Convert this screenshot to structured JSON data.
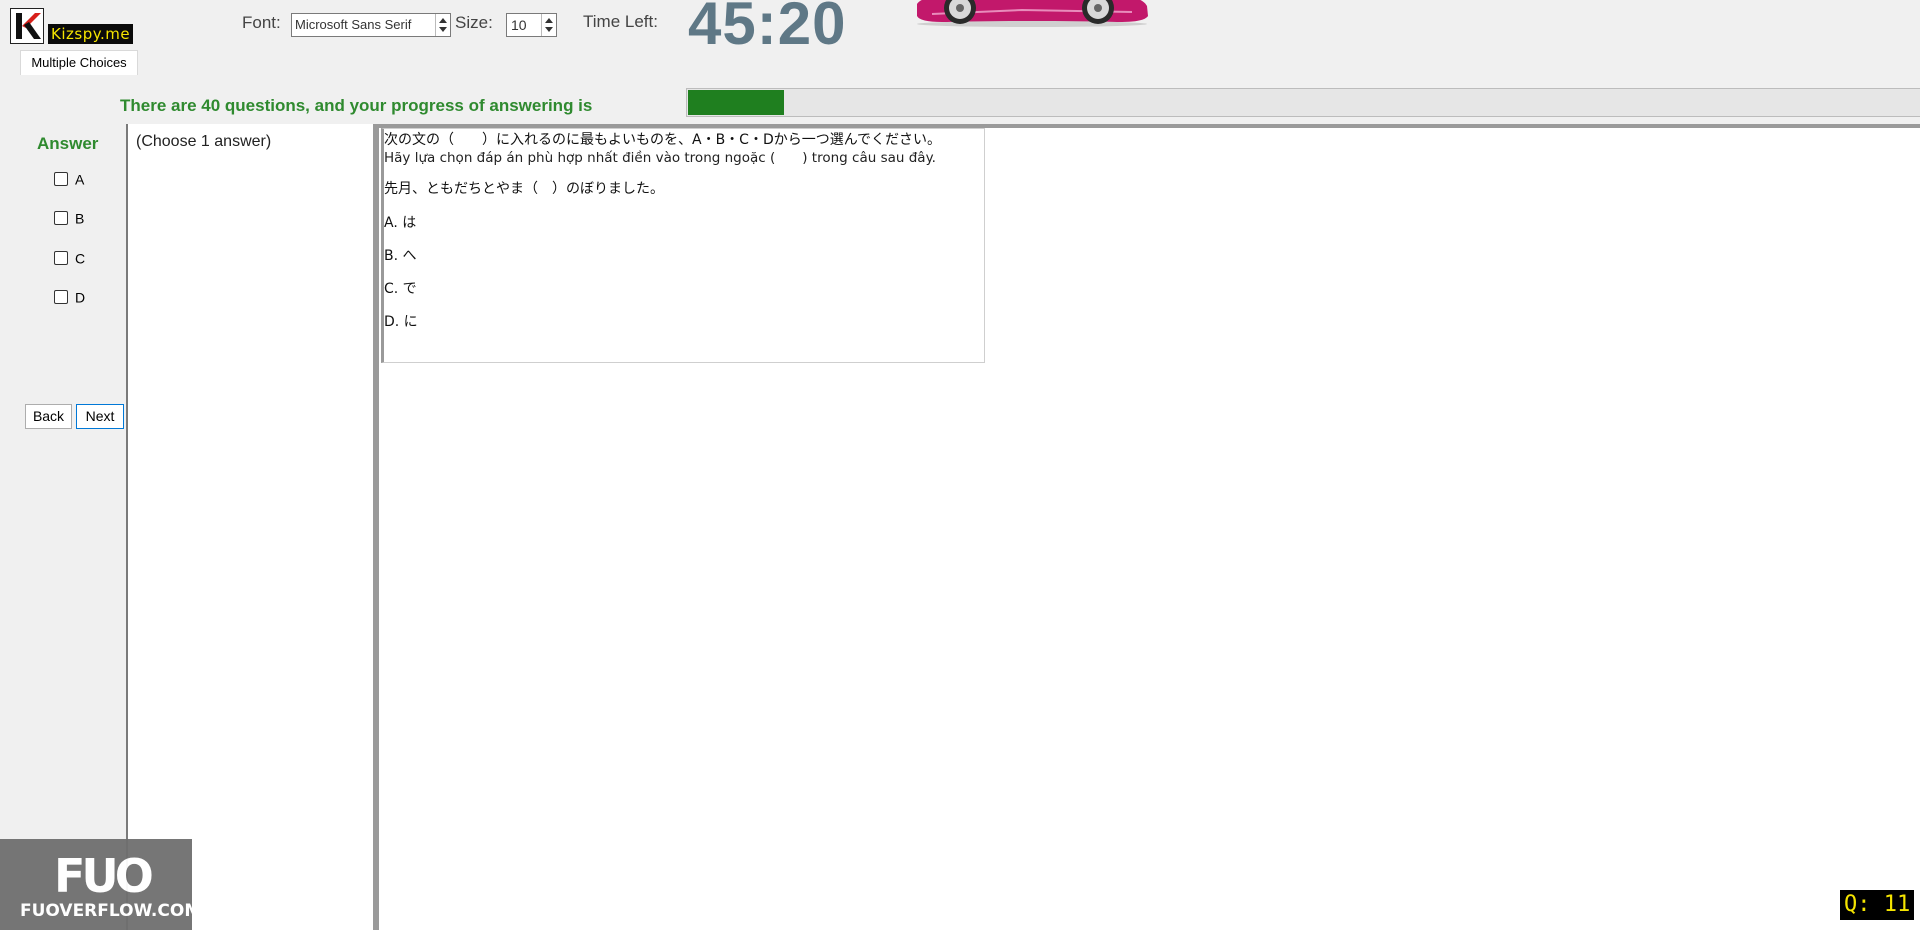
{
  "app": {
    "brand": "Kizspy.me",
    "tab_label": "Multiple Choices"
  },
  "header": {
    "font_label": "Font:",
    "font_value": "Microsoft Sans Serif",
    "size_label": "Size:",
    "size_value": "10",
    "time_label": "Time Left:",
    "timer": "45:20"
  },
  "progress": {
    "text": "There are 40 questions, and your progress of answering is",
    "fraction": 0.0775,
    "color": "#1f7f1f"
  },
  "answer": {
    "title": "Answer",
    "options": [
      "A",
      "B",
      "C",
      "D"
    ],
    "back_label": "Back",
    "next_label": "Next"
  },
  "instruction": "(Choose 1 answer)",
  "question": {
    "jp_prompt": "次の文の（　　）に入れるのに最もよいものを、A・B・C・Dから一つ選んでください。",
    "vi_prompt": "Hãy lựa chọn đáp án phù hợp nhất điền vào trong ngoặc (　　) trong câu sau đây.",
    "sentence": "先月、ともだちとやま（　）のぼりました。",
    "choices": [
      "A.  は",
      "B.  へ",
      "C.  で",
      "D.  に"
    ]
  },
  "watermark": {
    "logo": "FUO",
    "text": "FUOVERFLOW.COM"
  },
  "counter": "Q: 11",
  "colors": {
    "accent_green": "#2f8a2f",
    "timer": "#5f7886",
    "brand_yellow": "#f5e400"
  }
}
